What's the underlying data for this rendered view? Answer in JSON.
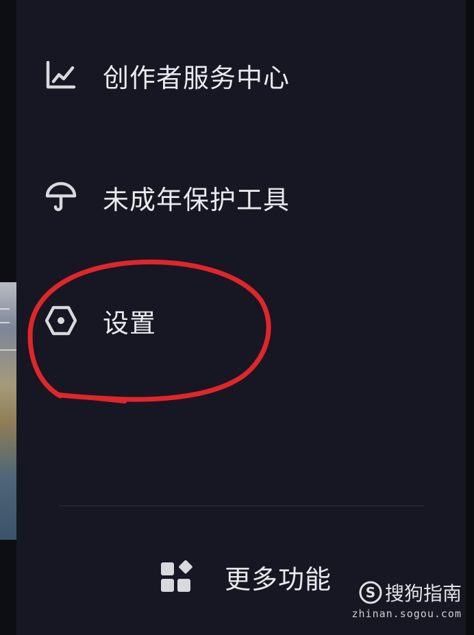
{
  "menu": {
    "items": [
      {
        "label": "创作者服务中心",
        "icon": "chart-line-icon"
      },
      {
        "label": "未成年保护工具",
        "icon": "umbrella-icon"
      },
      {
        "label": "设置",
        "icon": "settings-hexagon-icon"
      }
    ],
    "more_label": "更多功能",
    "more_icon": "apps-grid-icon"
  },
  "annotation": {
    "type": "hand-drawn circle",
    "color": "#e0262a",
    "target": "设置"
  },
  "watermark": {
    "name": "搜狗指南",
    "url": "zhinan.sogou.com"
  },
  "colors": {
    "drawer_bg": "#161722",
    "text": "#e9e9ee",
    "icon": "#d8d8dd"
  }
}
